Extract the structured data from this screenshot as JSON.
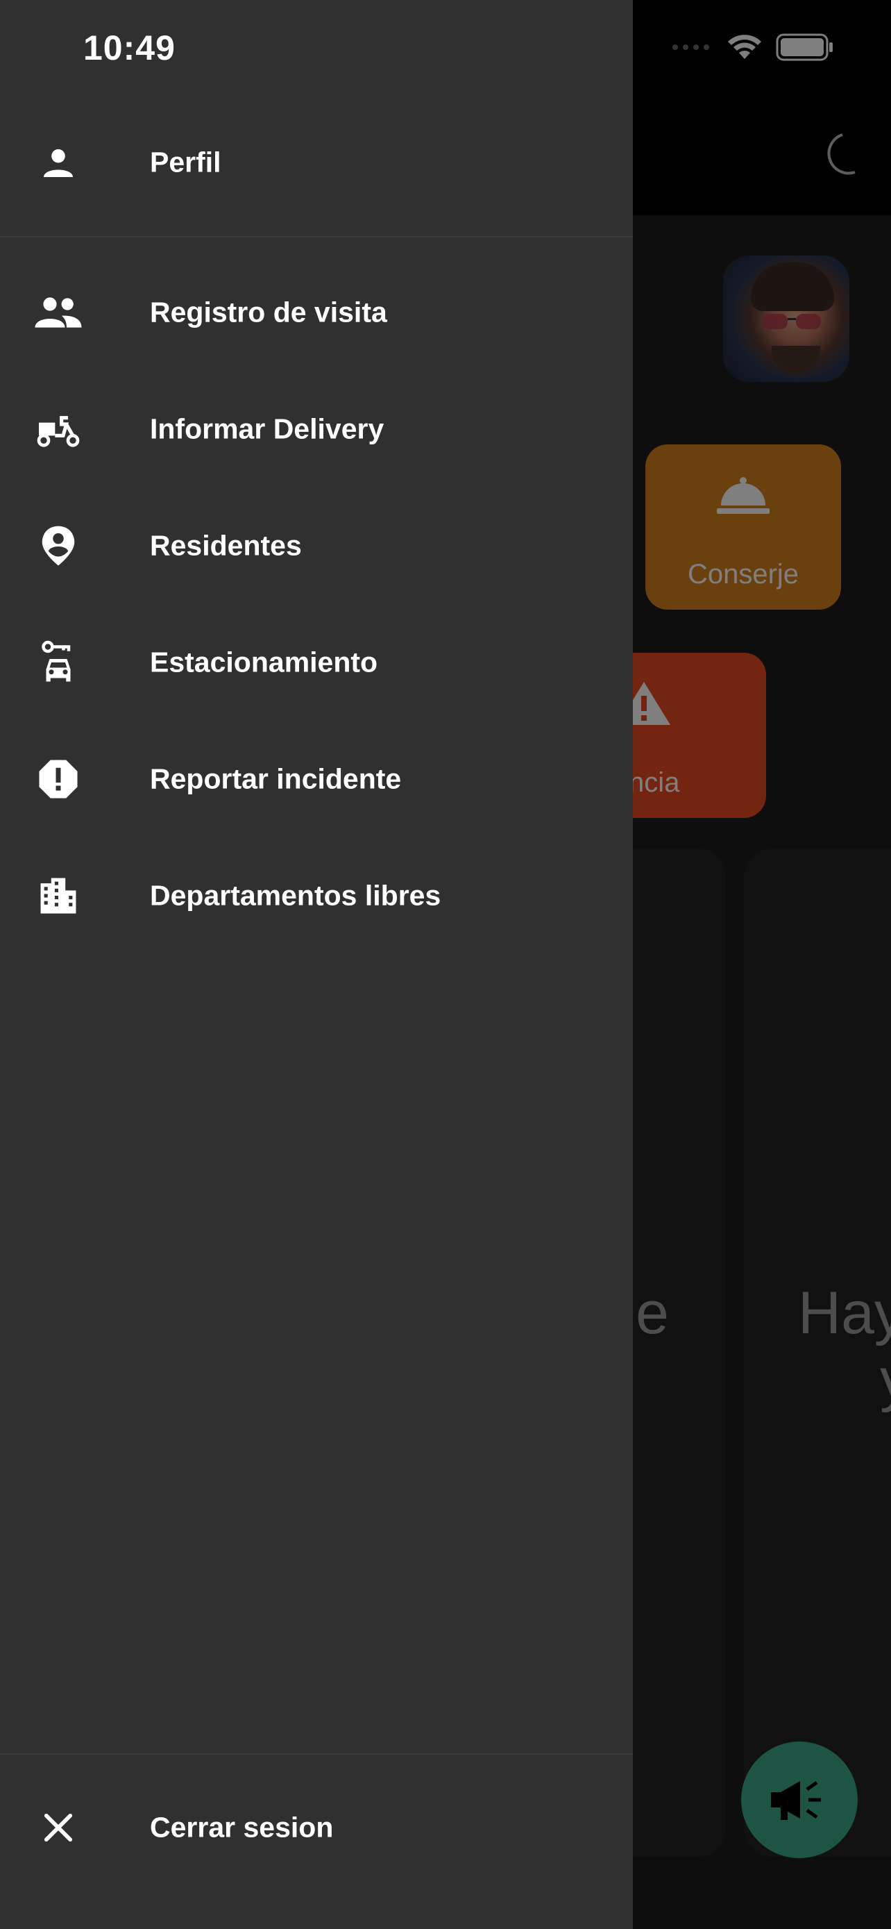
{
  "status_bar": {
    "time": "10:49"
  },
  "drawer": {
    "profile": {
      "label": "Perfil",
      "icon": "person-icon"
    },
    "items": [
      {
        "label": "Registro de visita",
        "icon": "people-icon"
      },
      {
        "label": "Informar Delivery",
        "icon": "delivery-scooter-icon"
      },
      {
        "label": "Residentes",
        "icon": "person-pin-icon"
      },
      {
        "label": "Estacionamiento",
        "icon": "car-key-icon"
      },
      {
        "label": "Reportar incidente",
        "icon": "report-octagon-icon"
      },
      {
        "label": "Departamentos libres",
        "icon": "building-icon"
      }
    ],
    "logout": {
      "label": "Cerrar sesion",
      "icon": "close-icon"
    }
  },
  "background": {
    "tiles": [
      {
        "label": "Conserje",
        "icon": "concierge-bell-icon",
        "color": "#d5801f"
      },
      {
        "label": "ergencia",
        "icon": "warning-icon",
        "color": "#e64a22"
      }
    ],
    "cards": [
      {
        "text": "e"
      },
      {
        "text": "Hay",
        "text2": "y"
      }
    ],
    "fab": {
      "icon": "megaphone-icon",
      "color": "#3aa887"
    }
  }
}
